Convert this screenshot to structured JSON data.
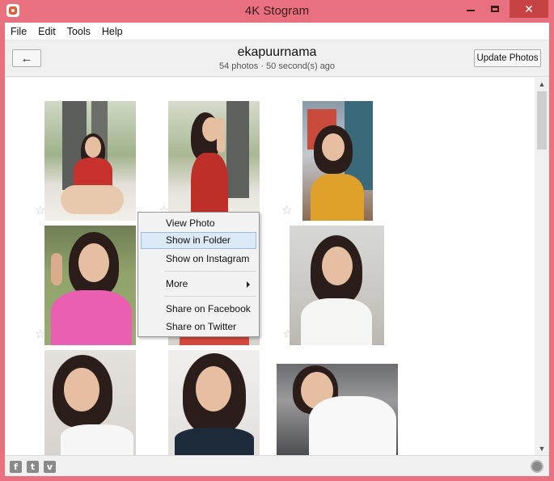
{
  "window": {
    "title": "4K Stogram",
    "close_glyph": "✕"
  },
  "menubar": {
    "items": [
      "File",
      "Edit",
      "Tools",
      "Help"
    ]
  },
  "header": {
    "back_glyph": "←",
    "username": "ekapuurnama",
    "meta": "54 photos · 50 second(s) ago",
    "update_label": "Update Photos"
  },
  "context_menu": {
    "view_photo": "View Photo",
    "show_in_folder": "Show in Folder",
    "show_on_instagram": "Show on Instagram",
    "more": "More",
    "share_facebook": "Share on Facebook",
    "share_twitter": "Share on Twitter",
    "highlighted": "Show in Folder"
  },
  "footer": {
    "facebook": "f",
    "twitter": "t",
    "vimeo": "v"
  },
  "star_glyph": "☆",
  "colors": {
    "window_frame": "#e8707f",
    "close_button": "#c74343",
    "menu_highlight": "#dbe8f6"
  },
  "icons": [
    "app-logo-icon",
    "back-arrow-icon",
    "star-icon",
    "chevron-right-icon",
    "facebook-icon",
    "twitter-icon",
    "vimeo-icon",
    "globe-icon",
    "scroll-up-icon",
    "scroll-down-icon"
  ]
}
